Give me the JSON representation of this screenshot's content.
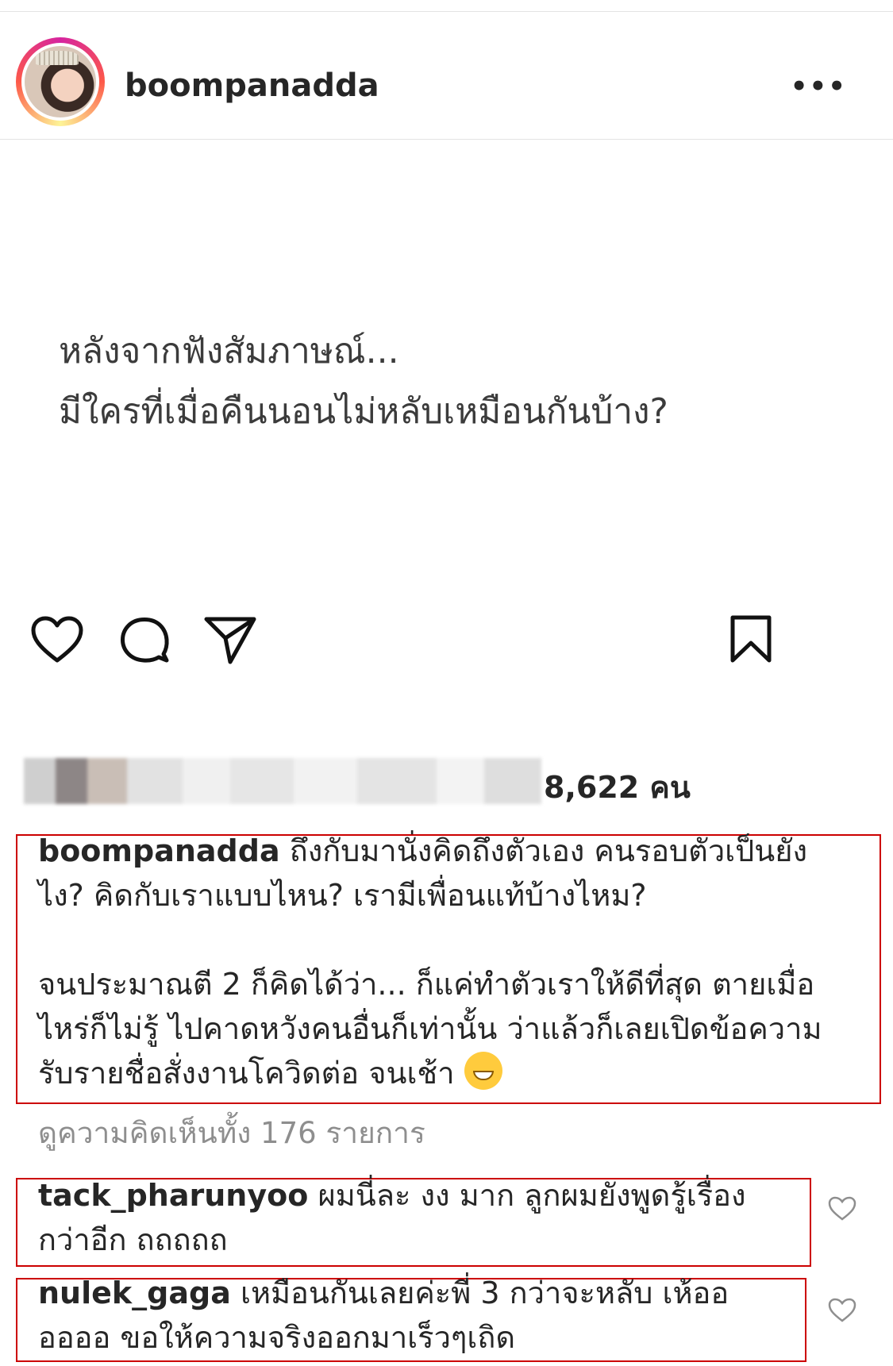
{
  "header": {
    "username": "boompanadda",
    "more_icon": "more-horizontal-icon"
  },
  "post": {
    "text_lines": [
      "หลังจากฟังสัมภาษณ์...",
      "มีใครที่เมื่อคืนนอนไม่หลับเหมือนกันบ้าง?"
    ]
  },
  "actions": {
    "like_icon": "heart-icon",
    "comment_icon": "comment-icon",
    "share_icon": "send-icon",
    "save_icon": "bookmark-icon"
  },
  "likes": {
    "count_text": "8,622 คน"
  },
  "caption": {
    "username": "boompanadda",
    "lines": [
      "ถึงกับมานั่งคิดถึงตัวเอง คนรอบตัวเป็นยัง",
      "ไง? คิดกับเราแบบไหน? เรามีเพื่อนแท้บ้างไหม?",
      "",
      "จนประมาณตี 2 ก็คิดได้ว่า... ก็แค่ทำตัวเราให้ดีที่สุด ตายเมื่อ",
      "ไหร่ก็ไม่รู้ ไปคาดหวังคนอื่นก็เท่านั้น ว่าแล้วก็เลยเปิดข้อความ",
      "รับรายชื่อสั่งงานโควิดต่อ จนเช้า"
    ],
    "emoji": "grinning-sweat-emoji"
  },
  "view_all": "ดูความคิดเห็นทั้ง 176 รายการ",
  "comments": [
    {
      "username": "tack_pharunyoo",
      "line1": "ผมนี่ละ งง มาก ลูกผมยังพูดรู้เรื่อง",
      "line2": "กว่าอีก ถถถถถ"
    },
    {
      "username": "nulek_gaga",
      "line1": "เหมือนกันเลยค่ะพี่ 3  กว่าจะหลับ  เห้ออ",
      "line2": "ออออ  ขอให้ความจริงออกมาเร็วๆเถิด"
    }
  ],
  "colors": {
    "highlight_box": "#cc0000",
    "text": "#262626",
    "muted": "#8e8e8e"
  }
}
